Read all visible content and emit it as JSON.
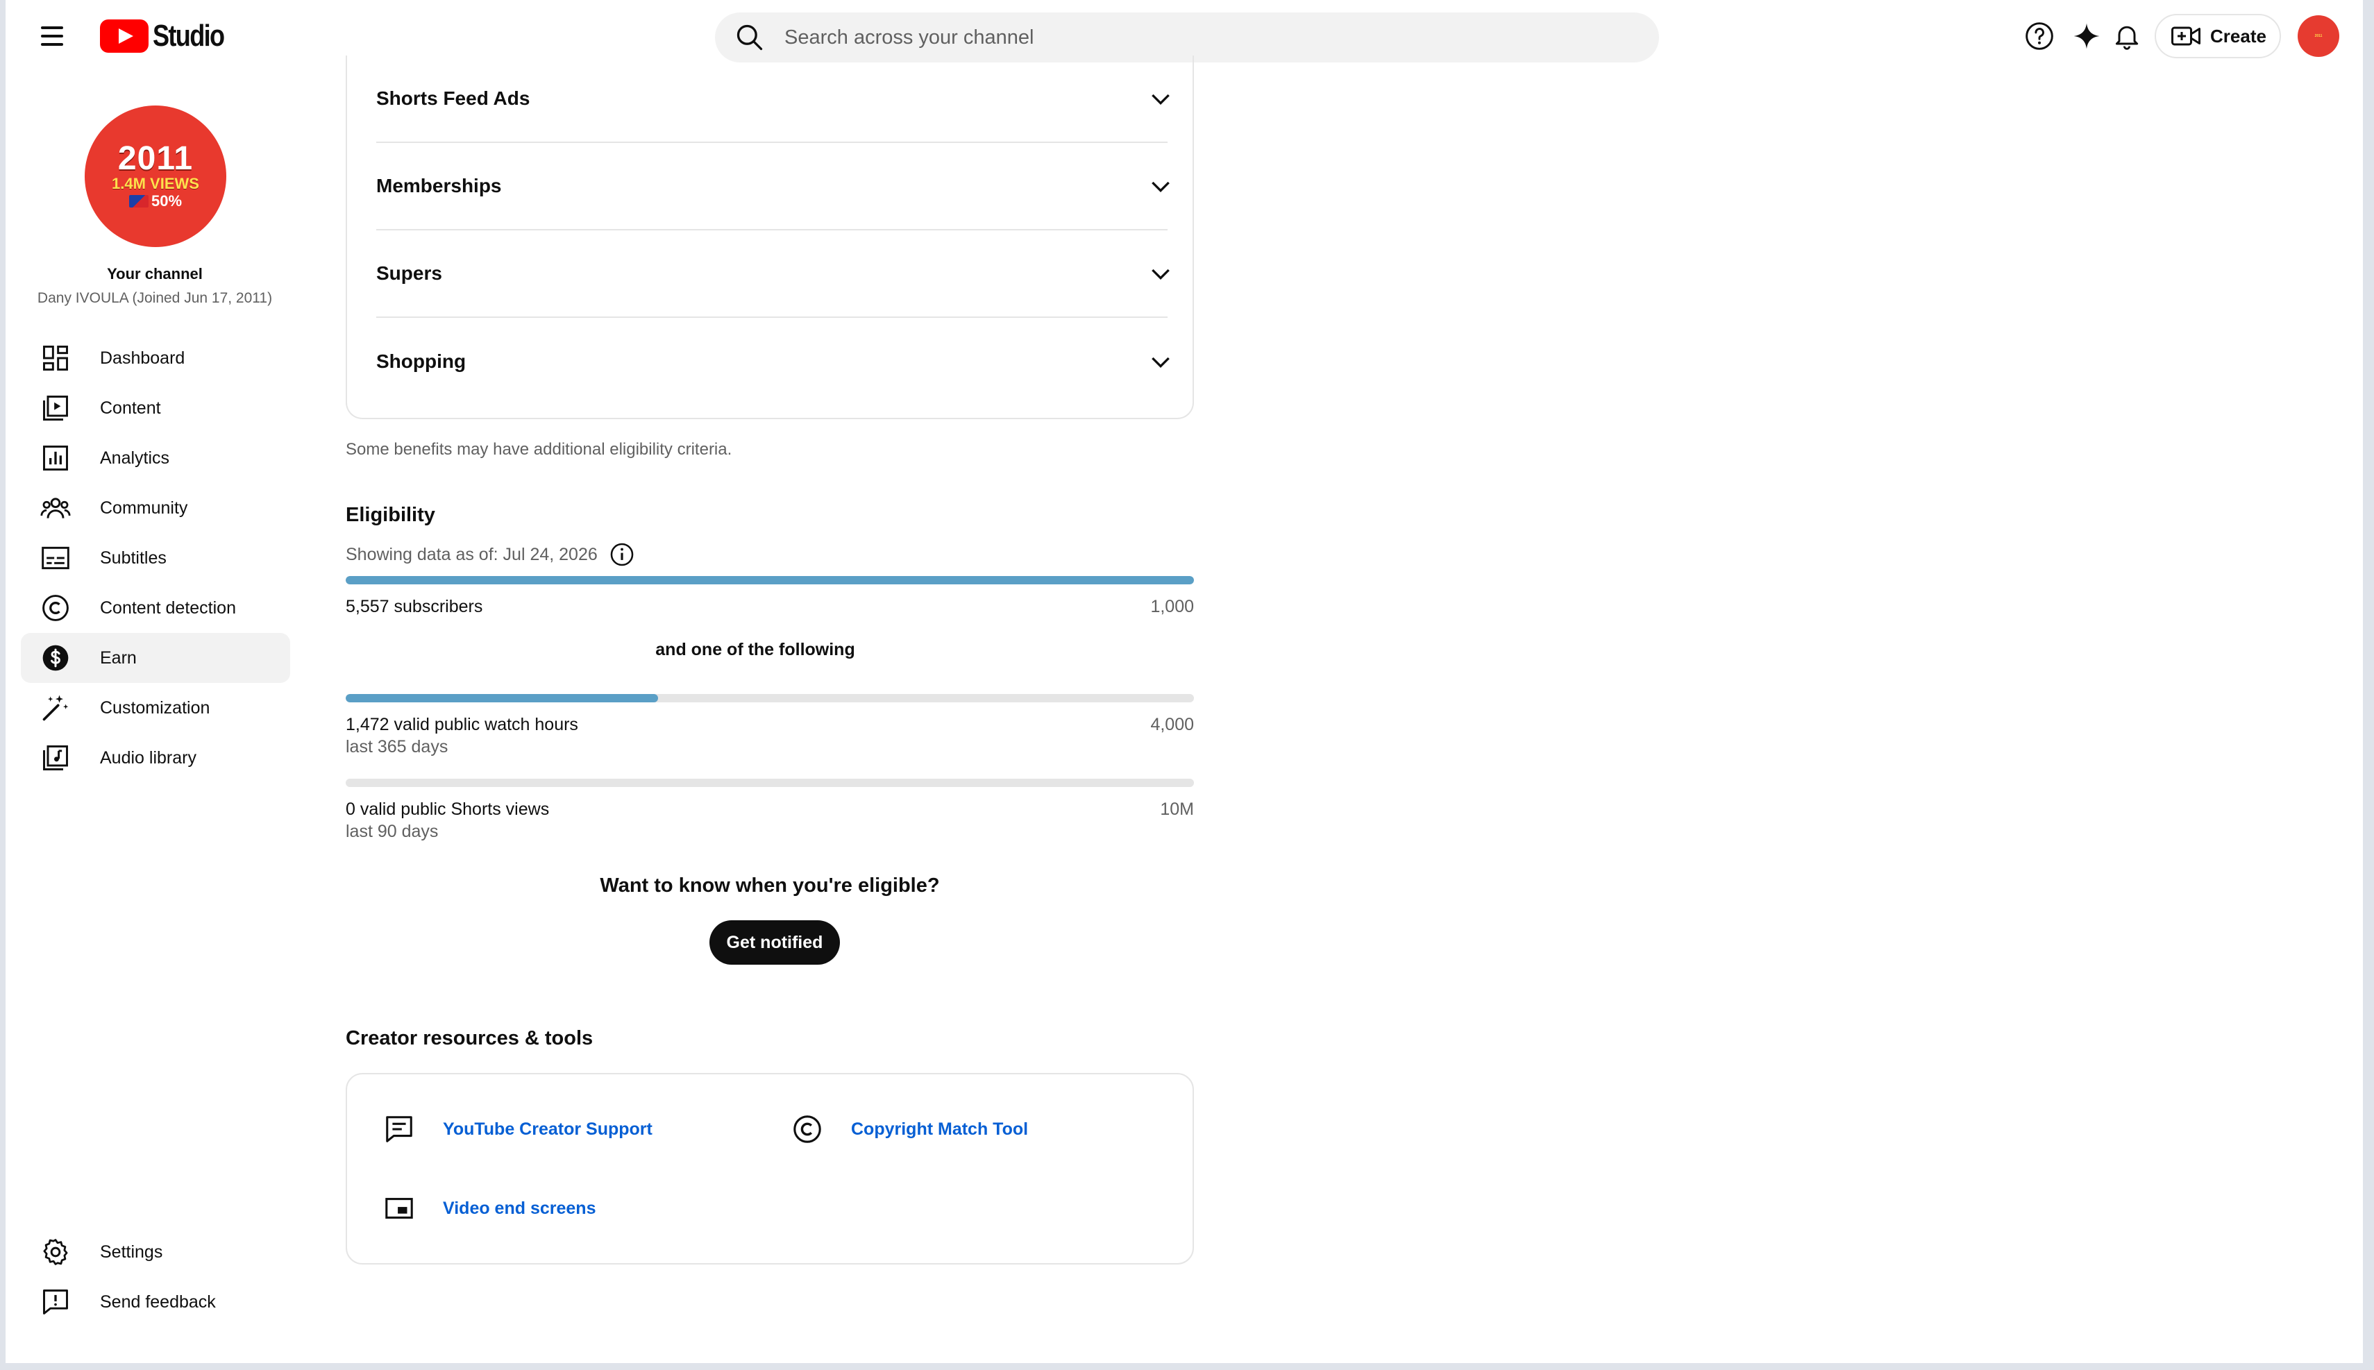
{
  "header": {
    "logo_text": "Studio",
    "search_placeholder": "Search across your channel",
    "create_label": "Create",
    "avatar_text": "2011"
  },
  "sidebar": {
    "avatar": {
      "year": "2011",
      "views": "1.4M VIEWS",
      "percent": "50%"
    },
    "channel_label": "Your channel",
    "channel_sub": "Dany IVOULA (Joined Jun 17, 2011)",
    "items": [
      {
        "label": "Dashboard",
        "icon": "dashboard-icon"
      },
      {
        "label": "Content",
        "icon": "content-icon"
      },
      {
        "label": "Analytics",
        "icon": "analytics-icon"
      },
      {
        "label": "Community",
        "icon": "community-icon"
      },
      {
        "label": "Subtitles",
        "icon": "subtitles-icon"
      },
      {
        "label": "Content detection",
        "icon": "copyright-icon"
      },
      {
        "label": "Earn",
        "icon": "dollar-icon",
        "active": true
      },
      {
        "label": "Customization",
        "icon": "magic-wand-icon"
      },
      {
        "label": "Audio library",
        "icon": "audio-library-icon"
      }
    ],
    "bottom": [
      {
        "label": "Settings",
        "icon": "gear-icon"
      },
      {
        "label": "Send feedback",
        "icon": "feedback-icon"
      }
    ]
  },
  "benefits": {
    "items": [
      "Shorts Feed Ads",
      "Memberships",
      "Supers",
      "Shopping"
    ],
    "note": "Some benefits may have additional eligibility criteria."
  },
  "eligibility": {
    "title": "Eligibility",
    "date_text": "Showing data as of: Jul 24, 2026",
    "subscribers": {
      "label": "5,557 subscribers",
      "goal": "1,000",
      "progress": 1.0
    },
    "and_text": "and one of the following",
    "watch_hours": {
      "label": "1,472 valid public watch hours",
      "sub": "last 365 days",
      "goal": "4,000",
      "progress": 0.368
    },
    "shorts_views": {
      "label": "0 valid public Shorts views",
      "sub": "last 90 days",
      "goal": "10M",
      "progress": 0
    },
    "want_text": "Want to know when you're eligible?",
    "notify_label": "Get notified"
  },
  "resources": {
    "title": "Creator resources & tools",
    "items": [
      {
        "label": "YouTube Creator Support",
        "icon": "support-chat-icon"
      },
      {
        "label": "Copyright Match Tool",
        "icon": "copyright-icon"
      },
      {
        "label": "Video end screens",
        "icon": "end-screen-icon"
      }
    ]
  },
  "colors": {
    "accent": "#065fd4",
    "progress": "#5a9fc6",
    "brand_red": "#ff0000"
  }
}
